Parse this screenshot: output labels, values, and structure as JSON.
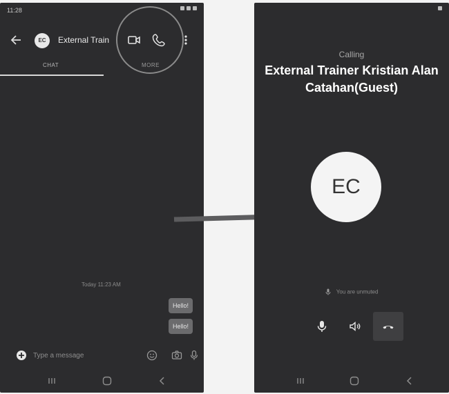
{
  "left_screen": {
    "status_time": "11:28",
    "header": {
      "avatar_initials": "EC",
      "title": "External Train"
    },
    "tabs": [
      {
        "label": "CHAT"
      },
      {
        "label": "MORE"
      }
    ],
    "messages": {
      "timestamp": "Today 11:23 AM",
      "bubbles": [
        "Hello!",
        "Hello!"
      ]
    },
    "composer": {
      "placeholder": "Type a message"
    }
  },
  "right_screen": {
    "status_label": "Calling",
    "caller_name": "External Trainer Kristian Alan Catahan(Guest)",
    "avatar_initials": "EC",
    "muted_notice": "You are unmuted",
    "controls": [
      {
        "icon": "microphone-icon"
      },
      {
        "icon": "speaker-icon"
      },
      {
        "icon": "hang-up-icon"
      }
    ]
  },
  "colors": {
    "screen_background": "#2c2c2e",
    "page_background": "#f3f3f3",
    "arrow": "#5c5c5e",
    "hangup_button": "#3f3f41"
  }
}
